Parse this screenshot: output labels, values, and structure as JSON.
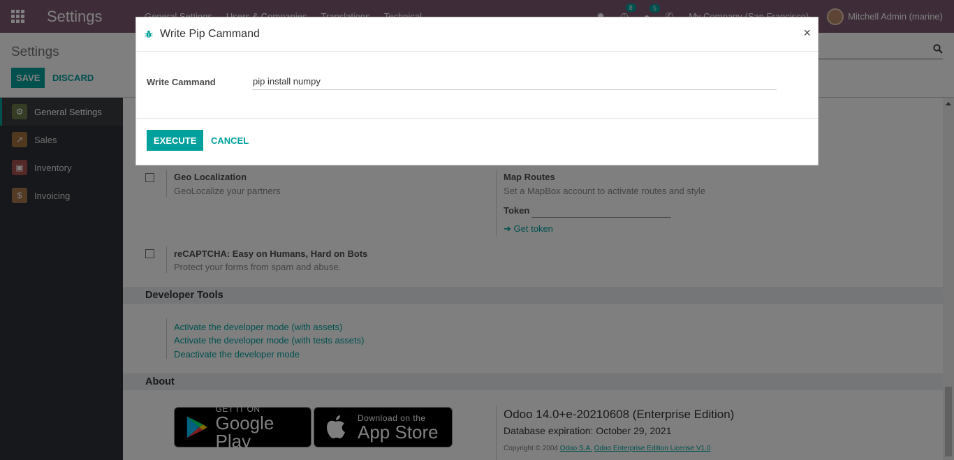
{
  "navbar": {
    "app_title": "Settings",
    "menu": [
      "General Settings",
      "Users & Companies",
      "Translations",
      "Technical"
    ],
    "activity_badge": "8",
    "messages_badge": "5",
    "company": "My Company (San Francisco)",
    "user": "Mitchell Admin (marine)",
    "bg_color": "#7c5a73"
  },
  "control_panel": {
    "title": "Settings",
    "save_label": "SAVE",
    "discard_label": "DISCARD"
  },
  "sidebar": {
    "items": [
      {
        "label": "General Settings",
        "icon": "gear-icon",
        "active": true
      },
      {
        "label": "Sales",
        "icon": "chart-icon"
      },
      {
        "label": "Inventory",
        "icon": "box-icon"
      },
      {
        "label": "Invoicing",
        "icon": "invoice-icon"
      }
    ]
  },
  "settings": {
    "geo": {
      "title": "Geo Localization",
      "desc": "GeoLocalize your partners"
    },
    "map": {
      "title": "Map Routes",
      "desc": "Set a MapBox account to activate routes and style",
      "token_label": "Token",
      "get_token": "Get token"
    },
    "recaptcha": {
      "title": "reCAPTCHA: Easy on Humans, Hard on Bots",
      "desc": "Protect your forms from spam and abuse."
    },
    "dev_tools": {
      "heading": "Developer Tools",
      "links": [
        "Activate the developer mode (with assets)",
        "Activate the developer mode (with tests assets)",
        "Deactivate the developer mode"
      ]
    },
    "about": {
      "heading": "About",
      "google_small": "GET IT ON",
      "google_big": "Google Play",
      "apple_small": "Download on the",
      "apple_big": "App Store",
      "version": "Odoo 14.0+e-20210608 (Enterprise Edition)",
      "expiry": "Database expiration: October 29, 2021",
      "copyright_prefix": "Copyright © 2004",
      "copyright_company": "Odoo S.A.",
      "copyright_license": "Odoo Enterprise Edition License V1.0"
    }
  },
  "modal": {
    "title": "Write Pip Cammand",
    "close": "×",
    "field_label": "Write Cammand",
    "field_value": "pip install numpy",
    "execute_label": "EXECUTE",
    "cancel_label": "CANCEL"
  },
  "colors": {
    "accent": "#00a09d",
    "navbar": "#7c5a73",
    "sidebar": "#2f3136"
  }
}
